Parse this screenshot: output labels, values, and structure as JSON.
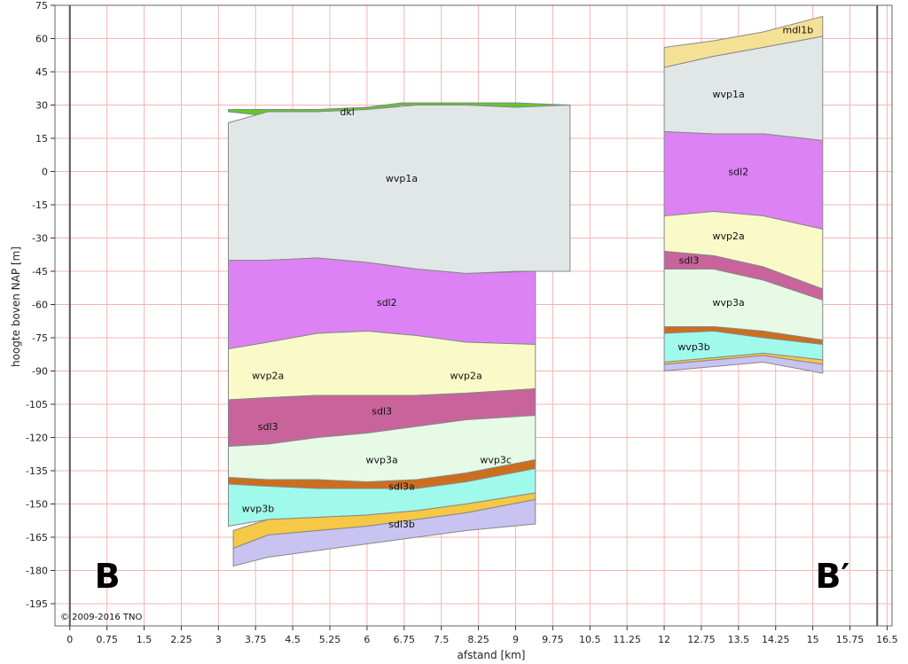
{
  "chart_data": {
    "type": "area",
    "xlabel": "afstand [km]",
    "ylabel": "hoogte boven NAP [m]",
    "xlim": [
      -0.3,
      16.6
    ],
    "ylim": [
      -205,
      75
    ],
    "x_ticks": [
      "0",
      "0.75",
      "1.5",
      "2.25",
      "3",
      "3.75",
      "4.5",
      "5.25",
      "6",
      "6.75",
      "7.5",
      "8.25",
      "9",
      "9.75",
      "10.5",
      "11.25",
      "12",
      "12.75",
      "13.5",
      "14.25",
      "15",
      "15.75",
      "16.5"
    ],
    "y_ticks": [
      "75",
      "60",
      "45",
      "30",
      "15",
      "0",
      "-15",
      "-30",
      "-45",
      "-60",
      "-75",
      "-90",
      "-105",
      "-120",
      "-135",
      "-150",
      "-165",
      "-180",
      "-195"
    ],
    "grid": true,
    "section_start_label": "B",
    "section_end_label": "B′",
    "copyright": "© 2009-2016 TNO",
    "colors": {
      "dkl": "#5fc82d",
      "wvp1a": "#e1e6e6",
      "sdl2": "#dc82f5",
      "wvp2a": "#fafac8",
      "sdl3": "#c8649b",
      "wvp3a": "#e6fae6",
      "wvp3c": "#e6fae6",
      "sdl3a": "#cd6e1e",
      "wvp3b": "#a0faeb",
      "sdl3b": "#f5c846",
      "base": "#c8c3f0",
      "mdl1b": "#f5e196",
      "boundary": "#888888"
    },
    "panels": [
      {
        "layers": [
          {
            "name": "dkl",
            "color_key": "dkl",
            "x": [
              3.2,
              4.0,
              5.0,
              6.0,
              6.7,
              8.0,
              9.0,
              10.1
            ],
            "top": [
              28,
              28,
              28,
              29,
              31,
              31,
              31,
              30
            ],
            "bottom": [
              27,
              25,
              26,
              27,
              30,
              30,
              29,
              29
            ]
          },
          {
            "name": "wvp1a",
            "color_key": "wvp1a",
            "x": [
              3.2,
              4.0,
              5.0,
              6.0,
              7.0,
              8.0,
              9.0,
              10.1
            ],
            "top": [
              22,
              27,
              27,
              28,
              30,
              30,
              29,
              30
            ],
            "bottom": [
              -40,
              -40,
              -39,
              -41,
              -44,
              -46,
              -45,
              -45
            ]
          },
          {
            "name": "sdl2",
            "color_key": "sdl2",
            "x": [
              3.2,
              4.0,
              5.0,
              6.0,
              7.0,
              8.0,
              9.4
            ],
            "top": [
              -40,
              -40,
              -39,
              -41,
              -44,
              -46,
              -45
            ],
            "bottom": [
              -80,
              -77,
              -73,
              -72,
              -74,
              -77,
              -78
            ]
          },
          {
            "name": "wvp2a",
            "color_key": "wvp2a",
            "x": [
              3.2,
              4.0,
              5.0,
              6.0,
              7.0,
              8.0,
              9.4
            ],
            "top": [
              -80,
              -77,
              -73,
              -72,
              -74,
              -77,
              -78
            ],
            "bottom": [
              -103,
              -102,
              -101,
              -101,
              -101,
              -100,
              -98
            ]
          },
          {
            "name": "sdl3",
            "color_key": "sdl3",
            "x": [
              3.2,
              4.0,
              5.0,
              6.0,
              7.0,
              8.0,
              9.4
            ],
            "top": [
              -103,
              -102,
              -101,
              -101,
              -101,
              -100,
              -98
            ],
            "bottom": [
              -124,
              -123,
              -120,
              -118,
              -115,
              -112,
              -110
            ]
          },
          {
            "name": "wvp3a",
            "color_key": "wvp3a",
            "x": [
              3.2,
              4.0,
              5.0,
              6.0,
              7.0,
              8.0,
              9.4
            ],
            "top": [
              -124,
              -123,
              -120,
              -118,
              -115,
              -112,
              -110
            ],
            "bottom": [
              -138,
              -141,
              -141,
              -141,
              -140,
              -137,
              -131
            ]
          },
          {
            "name": "sdl3a",
            "color_key": "sdl3a",
            "x": [
              3.2,
              4.0,
              5.0,
              6.0,
              7.0,
              8.0,
              9.4
            ],
            "top": [
              -138,
              -139,
              -139,
              -140,
              -139,
              -136,
              -130
            ],
            "bottom": [
              -141,
              -142,
              -143,
              -143,
              -143,
              -140,
              -134
            ]
          },
          {
            "name": "wvp3b",
            "color_key": "wvp3b",
            "x": [
              3.2,
              4.0,
              5.0,
              6.0,
              7.0,
              8.0,
              9.4
            ],
            "top": [
              -141,
              -142,
              -143,
              -143,
              -143,
              -140,
              -134
            ],
            "bottom": [
              -160,
              -157,
              -156,
              -155,
              -153,
              -150,
              -145
            ]
          },
          {
            "name": "sdl3b",
            "color_key": "sdl3b",
            "x": [
              3.3,
              4.0,
              5.0,
              6.0,
              7.0,
              8.0,
              9.4
            ],
            "top": [
              -162,
              -157,
              -156,
              -155,
              -153,
              -150,
              -145
            ],
            "bottom": [
              -170,
              -164,
              -162,
              -160,
              -157,
              -154,
              -148
            ]
          },
          {
            "name": "",
            "color_key": "base",
            "x": [
              3.3,
              4.0,
              5.0,
              6.0,
              7.0,
              8.0,
              9.4
            ],
            "top": [
              -170,
              -164,
              -162,
              -160,
              -157,
              -154,
              -148
            ],
            "bottom": [
              -178,
              -174,
              -171,
              -168,
              -165,
              -162,
              -159
            ]
          }
        ]
      },
      {
        "layers": [
          {
            "name": "mdl1b",
            "color_key": "mdl1b",
            "x": [
              12.0,
              13.0,
              14.0,
              15.2
            ],
            "top": [
              56,
              59,
              63,
              70
            ],
            "bottom": [
              47,
              52,
              56,
              61
            ]
          },
          {
            "name": "wvp1a",
            "color_key": "wvp1a",
            "x": [
              12.0,
              13.0,
              14.0,
              15.2
            ],
            "top": [
              47,
              52,
              56,
              61
            ],
            "bottom": [
              18,
              17,
              17,
              14
            ]
          },
          {
            "name": "sdl2",
            "color_key": "sdl2",
            "x": [
              12.0,
              13.0,
              14.0,
              15.2
            ],
            "top": [
              18,
              17,
              17,
              14
            ],
            "bottom": [
              -20,
              -18,
              -20,
              -26
            ]
          },
          {
            "name": "wvp2a",
            "color_key": "wvp2a",
            "x": [
              12.0,
              13.0,
              14.0,
              15.2
            ],
            "top": [
              -20,
              -18,
              -20,
              -26
            ],
            "bottom": [
              -36,
              -38,
              -43,
              -53
            ]
          },
          {
            "name": "sdl3",
            "color_key": "sdl3",
            "x": [
              12.0,
              13.0,
              14.0,
              15.2
            ],
            "top": [
              -36,
              -38,
              -43,
              -53
            ],
            "bottom": [
              -44,
              -44,
              -49,
              -58
            ]
          },
          {
            "name": "wvp3a",
            "color_key": "wvp3a",
            "x": [
              12.0,
              13.0,
              14.0,
              15.2
            ],
            "top": [
              -44,
              -44,
              -49,
              -58
            ],
            "bottom": [
              -70,
              -70,
              -72,
              -76
            ]
          },
          {
            "name": "",
            "color_key": "sdl3a",
            "x": [
              12.0,
              13.0,
              14.0,
              15.2
            ],
            "top": [
              -70,
              -70,
              -72,
              -76
            ],
            "bottom": [
              -73,
              -72,
              -75,
              -78
            ]
          },
          {
            "name": "wvp3b",
            "color_key": "wvp3b",
            "x": [
              12.0,
              13.0,
              14.0,
              15.2
            ],
            "top": [
              -73,
              -72,
              -75,
              -78
            ],
            "bottom": [
              -86,
              -84,
              -82,
              -85
            ]
          },
          {
            "name": "",
            "color_key": "sdl3b",
            "x": [
              12.0,
              13.0,
              14.0,
              15.2
            ],
            "top": [
              -86,
              -84,
              -82,
              -85
            ],
            "bottom": [
              -87,
              -85,
              -83,
              -87
            ]
          },
          {
            "name": "",
            "color_key": "base",
            "x": [
              12.0,
              13.0,
              14.0,
              15.2
            ],
            "top": [
              -87,
              -85,
              -83,
              -87
            ],
            "bottom": [
              -90,
              -88,
              -86,
              -91
            ]
          }
        ]
      }
    ],
    "annotations": [
      {
        "text": "dkl",
        "x": 5.6,
        "y": 27
      },
      {
        "text": "wvp1a",
        "x": 6.7,
        "y": -3
      },
      {
        "text": "sdl2",
        "x": 6.4,
        "y": -59
      },
      {
        "text": "wvp2a",
        "x": 4.0,
        "y": -92
      },
      {
        "text": "wvp2a",
        "x": 8.0,
        "y": -92
      },
      {
        "text": "sdl3",
        "x": 4.0,
        "y": -115
      },
      {
        "text": "sdl3",
        "x": 6.3,
        "y": -108
      },
      {
        "text": "wvp3a",
        "x": 6.3,
        "y": -130
      },
      {
        "text": "wvp3c",
        "x": 8.6,
        "y": -130
      },
      {
        "text": "sdl3a",
        "x": 6.7,
        "y": -142
      },
      {
        "text": "wvp3b",
        "x": 3.8,
        "y": -152
      },
      {
        "text": "sdl3b",
        "x": 6.7,
        "y": -159
      },
      {
        "text": "mdl1b",
        "x": 14.7,
        "y": 64
      },
      {
        "text": "wvp1a",
        "x": 13.3,
        "y": 35
      },
      {
        "text": "sdl2",
        "x": 13.5,
        "y": 0
      },
      {
        "text": "wvp2a",
        "x": 13.3,
        "y": -29
      },
      {
        "text": "sdl3",
        "x": 12.5,
        "y": -40
      },
      {
        "text": "wvp3a",
        "x": 13.3,
        "y": -59
      },
      {
        "text": "wvp3b",
        "x": 12.6,
        "y": -79
      }
    ]
  }
}
